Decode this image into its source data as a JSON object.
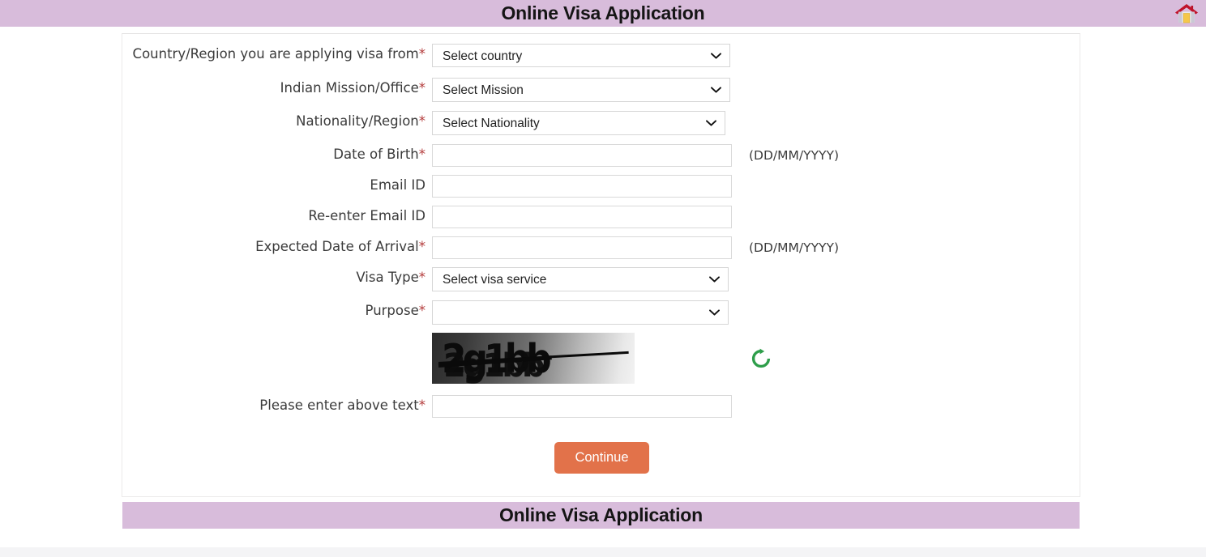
{
  "header": {
    "title": "Online Visa Application",
    "home_icon": "home-icon"
  },
  "footer": {
    "title": "Online Visa Application"
  },
  "form": {
    "fields": [
      {
        "label": "Country/Region you are applying visa from",
        "required": true,
        "control": "select",
        "value": "Select country",
        "hint": ""
      },
      {
        "label": "Indian Mission/Office",
        "required": true,
        "control": "select",
        "value": "Select Mission",
        "hint": ""
      },
      {
        "label": "Nationality/Region",
        "required": true,
        "control": "select",
        "value": "Select Nationality",
        "hint": ""
      },
      {
        "label": "Date of Birth",
        "required": true,
        "control": "text",
        "value": "",
        "placeholder": "",
        "hint": "(DD/MM/YYYY)"
      },
      {
        "label": "Email ID",
        "required": false,
        "control": "text",
        "value": "",
        "placeholder": "",
        "hint": ""
      },
      {
        "label": "Re-enter Email ID",
        "required": false,
        "control": "text",
        "value": "",
        "placeholder": "",
        "hint": ""
      },
      {
        "label": "Expected Date of Arrival",
        "required": true,
        "control": "text",
        "value": "",
        "placeholder": "",
        "hint": "(DD/MM/YYYY)"
      },
      {
        "label": "Visa Type",
        "required": true,
        "control": "select",
        "value": "Select visa service",
        "hint": ""
      },
      {
        "label": "Purpose",
        "required": true,
        "control": "select",
        "value": "",
        "hint": ""
      }
    ],
    "captcha": {
      "text": "2g1bb",
      "refresh_icon": "refresh-icon",
      "answer_label": "Please enter above text",
      "answer_required": true,
      "answer_value": "",
      "answer_placeholder": ""
    },
    "submit_label": "Continue",
    "required_marker": "*"
  },
  "colors": {
    "header_bar": "#d8bcdb",
    "submit_button": "#e2724a",
    "required_asterisk": "#b33a3a",
    "refresh_icon": "#2e9e4a",
    "home_roof": "#c0122a"
  }
}
